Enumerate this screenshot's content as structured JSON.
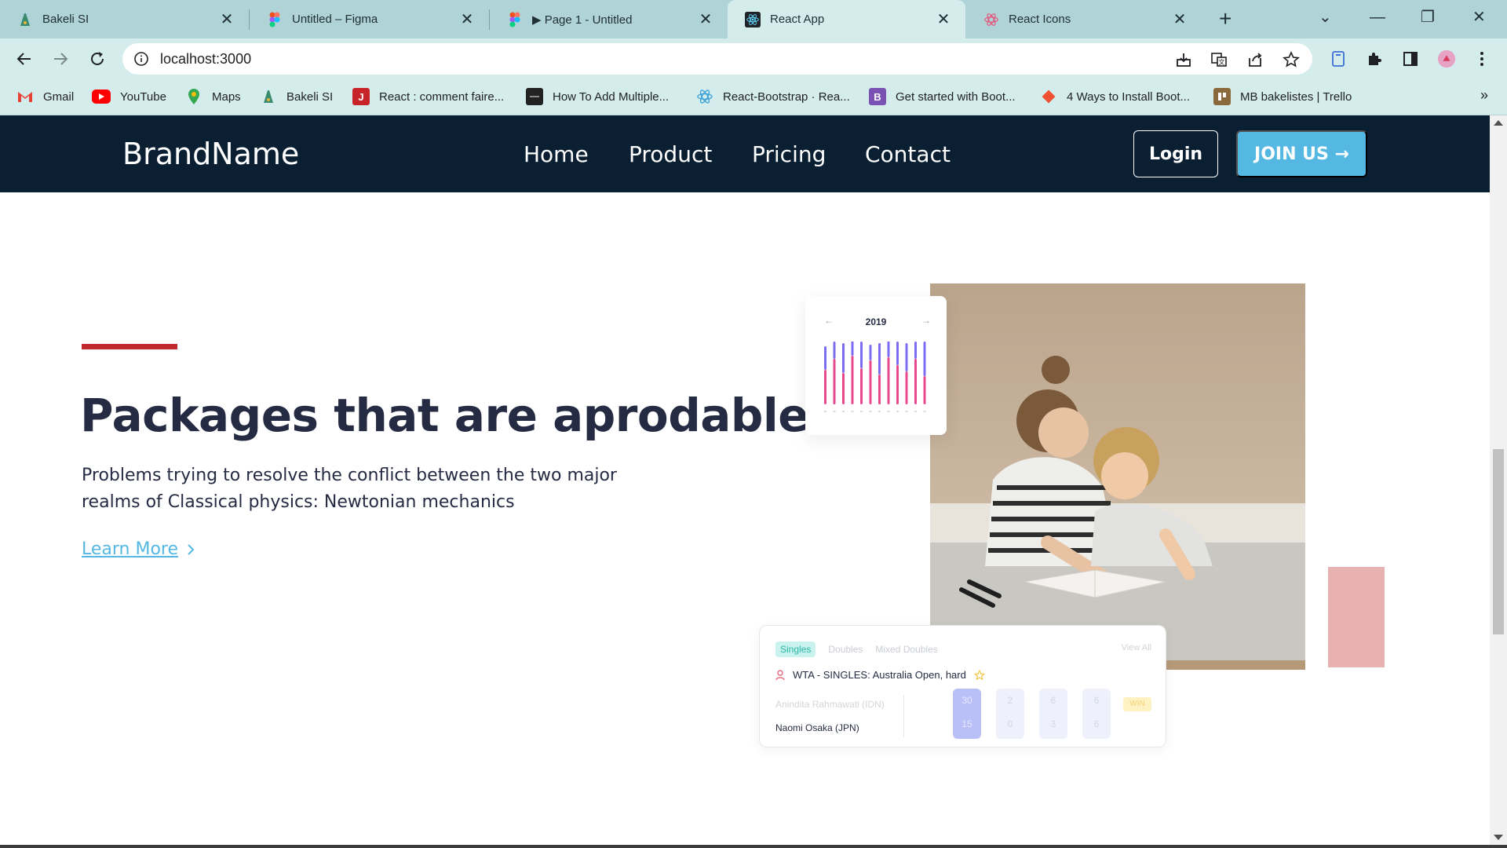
{
  "browser": {
    "tabs": [
      {
        "title": "Bakeli SI",
        "active": false,
        "icon": "bakeli-icon"
      },
      {
        "title": "Untitled – Figma",
        "active": false,
        "icon": "figma-icon"
      },
      {
        "title": "▶ Page 1 - Untitled",
        "active": false,
        "icon": "figma-icon"
      },
      {
        "title": "React App",
        "active": true,
        "icon": "react-icon"
      },
      {
        "title": "React Icons",
        "active": false,
        "icon": "react-icons-icon"
      }
    ],
    "url": "localhost:3000",
    "bookmarks": [
      {
        "label": "Gmail",
        "icon": "gmail-icon",
        "color": "#ea4335"
      },
      {
        "label": "YouTube",
        "icon": "youtube-icon",
        "color": "#ff0000"
      },
      {
        "label": "Maps",
        "icon": "maps-icon",
        "color": "#34a853"
      },
      {
        "label": "Bakeli SI",
        "icon": "bakeli-icon",
        "color": "#3a8c6e"
      },
      {
        "label": "React : comment faire...",
        "icon": "journal-icon",
        "color": "#c9232a"
      },
      {
        "label": "How To Add Multiple...",
        "icon": "site-icon",
        "color": "#222222"
      },
      {
        "label": "React-Bootstrap · Rea...",
        "icon": "react-bootstrap-icon",
        "color": "#20232a"
      },
      {
        "label": "Get started with Boot...",
        "icon": "bootstrap-icon",
        "color": "#7952b3"
      },
      {
        "label": "4 Ways to Install Boot...",
        "icon": "git-icon",
        "color": "#f05033"
      },
      {
        "label": "MB bakelistes | Trello",
        "icon": "trello-icon",
        "color": "#8a6a3c"
      }
    ]
  },
  "site": {
    "brand": "BrandName",
    "nav": [
      "Home",
      "Product",
      "Pricing",
      "Contact"
    ],
    "login_label": "Login",
    "join_label": "JOIN US →"
  },
  "hero": {
    "title": "Packages that are aprodable",
    "text": "Problems trying to resolve the conflict between the two major realms of Classical physics: Newtonian mechanics",
    "link_label": "Learn More"
  },
  "chart_card": {
    "year": "2019",
    "prev_arrow": "←",
    "next_arrow": "→"
  },
  "score_card": {
    "tabs": [
      "Singles",
      "Doubles",
      "Mixed Doubles"
    ],
    "view_all": "View All",
    "event": "WTA - SINGLES: Australia Open, hard",
    "player1": "Anindita Rahmawati (IDN)",
    "player2": "Naomi Osaka (JPN)",
    "scores": [
      {
        "top": "30",
        "bottom": "15"
      },
      {
        "top": "2",
        "bottom": "0"
      },
      {
        "top": "6",
        "bottom": "3"
      },
      {
        "top": "6",
        "bottom": "6"
      }
    ],
    "win_label": "WIN"
  },
  "colors": {
    "navbar": "#0b1f33",
    "accent": "#54b8e2",
    "red": "#c0282d",
    "heading": "#252b42"
  }
}
